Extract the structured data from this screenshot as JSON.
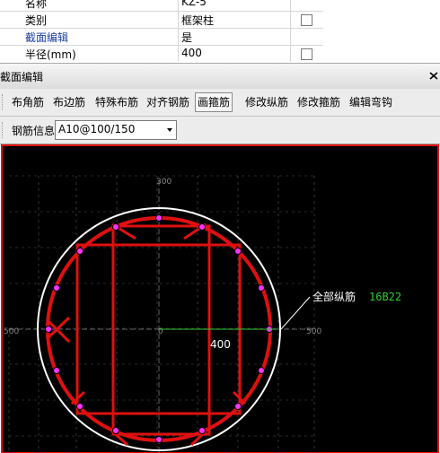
{
  "properties": {
    "rows": [
      {
        "label": "名称",
        "value": "KZ-5",
        "has_checkbox": false,
        "blue": false
      },
      {
        "label": "类别",
        "value": "框架柱",
        "has_checkbox": true,
        "blue": false
      },
      {
        "label": "截面编辑",
        "value": "是",
        "has_checkbox": false,
        "blue": true
      },
      {
        "label": "半径(mm)",
        "value": "400",
        "has_checkbox": true,
        "blue": false
      }
    ]
  },
  "window": {
    "title": "截面编辑"
  },
  "toolbar": {
    "items": [
      "布角筋",
      "布边筋",
      "特殊布筋",
      "对齐钢筋",
      "画箍筋",
      "修改纵筋",
      "修改箍筋",
      "编辑弯钩"
    ],
    "active_item": "画箍筋"
  },
  "rebar_info": {
    "label": "钢筋信息",
    "value": "A10@100/150"
  },
  "drawing": {
    "axis_labels": {
      "top": "300",
      "left": "500",
      "right": "500",
      "center": "0"
    },
    "radius_dimension": "400",
    "annotation_label": "全部纵筋",
    "annotation_value": "16B22",
    "colors": {
      "background": "#000000",
      "rebar": "#e01010",
      "outline": "#ffffff",
      "dots": "#ff33ff",
      "dimension": "#33cc33",
      "annotation_value": "#33cc33"
    }
  }
}
